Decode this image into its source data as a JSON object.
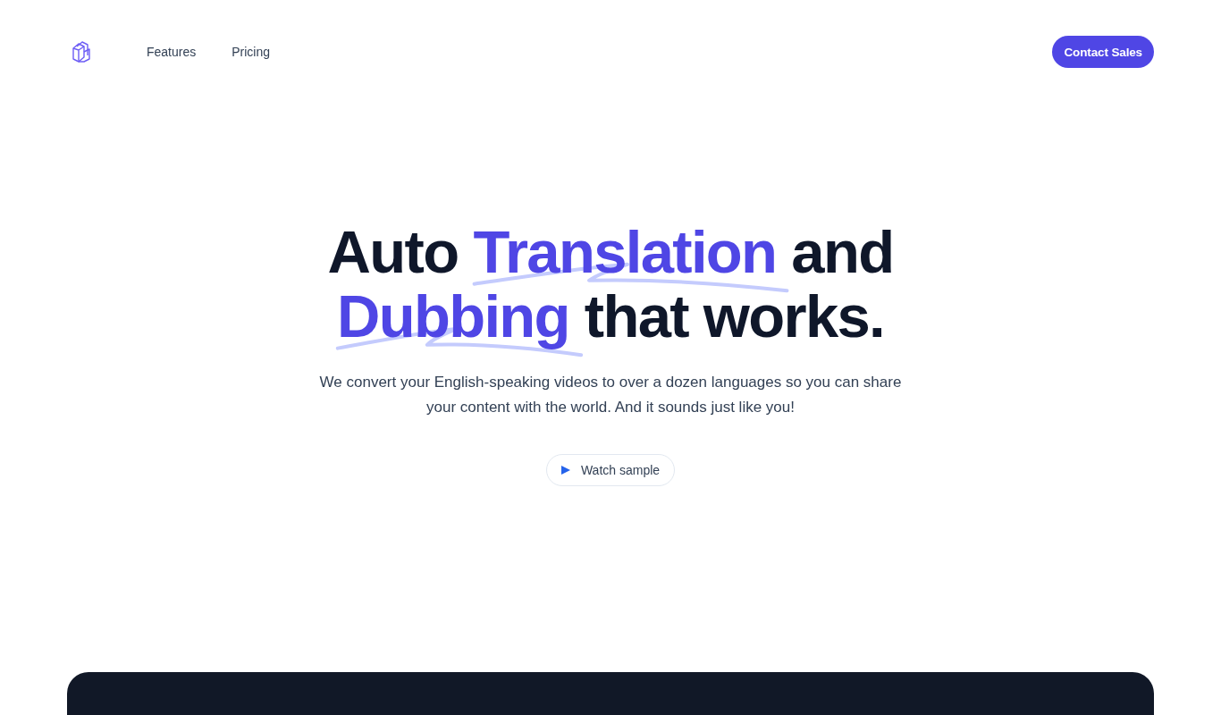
{
  "nav": {
    "links": [
      {
        "label": "Features"
      },
      {
        "label": "Pricing"
      }
    ],
    "cta": "Contact Sales"
  },
  "hero": {
    "headline": [
      {
        "text": "Auto ",
        "highlight": false
      },
      {
        "text": "Translation",
        "highlight": true
      },
      {
        "text": " and ",
        "highlight": false
      },
      {
        "text": "Dubbing",
        "highlight": true
      },
      {
        "text": " that works.",
        "highlight": false
      }
    ],
    "description": "We convert your English-speaking videos to over a dozen languages so you can share your content with the world. And it sounds just like you!",
    "button": "Watch sample"
  }
}
